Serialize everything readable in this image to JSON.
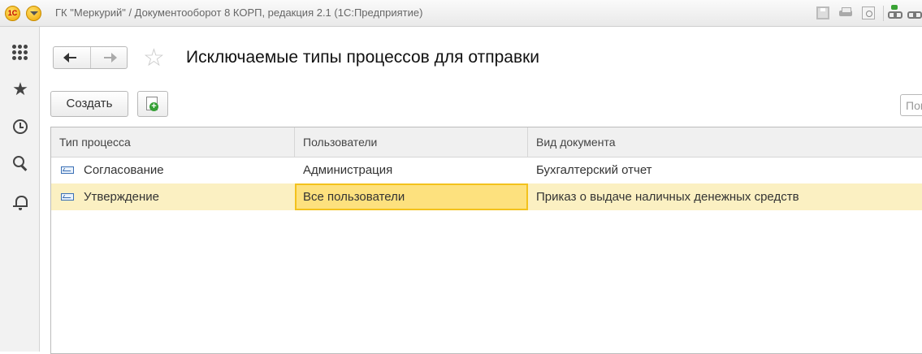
{
  "window": {
    "title": "ГК \"Меркурий\" / Документооборот 8 КОРП, редакция 2.1  (1С:Предприятие)",
    "logo_text": "1С"
  },
  "form": {
    "title": "Исключаемые типы процессов для отправки",
    "create_label": "Создать",
    "search_placeholder": "Пои"
  },
  "table": {
    "columns": [
      "Тип процесса",
      "Пользователи",
      "Вид документа"
    ],
    "rows": [
      {
        "process_type": "Согласование",
        "users": "Администрация",
        "document_type": "Бухгалтерский отчет"
      },
      {
        "process_type": "Утверждение",
        "users": "Все пользователи",
        "document_type": "Приказ о выдаче наличных денежных средств"
      }
    ],
    "selected_row": 1
  },
  "icons": {
    "left_panel": [
      "grid-icon",
      "star-icon",
      "history-icon",
      "search-icon",
      "bell-icon"
    ],
    "row": "process-icon"
  },
  "colors": {
    "selected_row": "#fbf0c2",
    "selected_cell": "#fde17e",
    "selected_cell_border": "#f3c21c",
    "logo": "#f0a400"
  }
}
